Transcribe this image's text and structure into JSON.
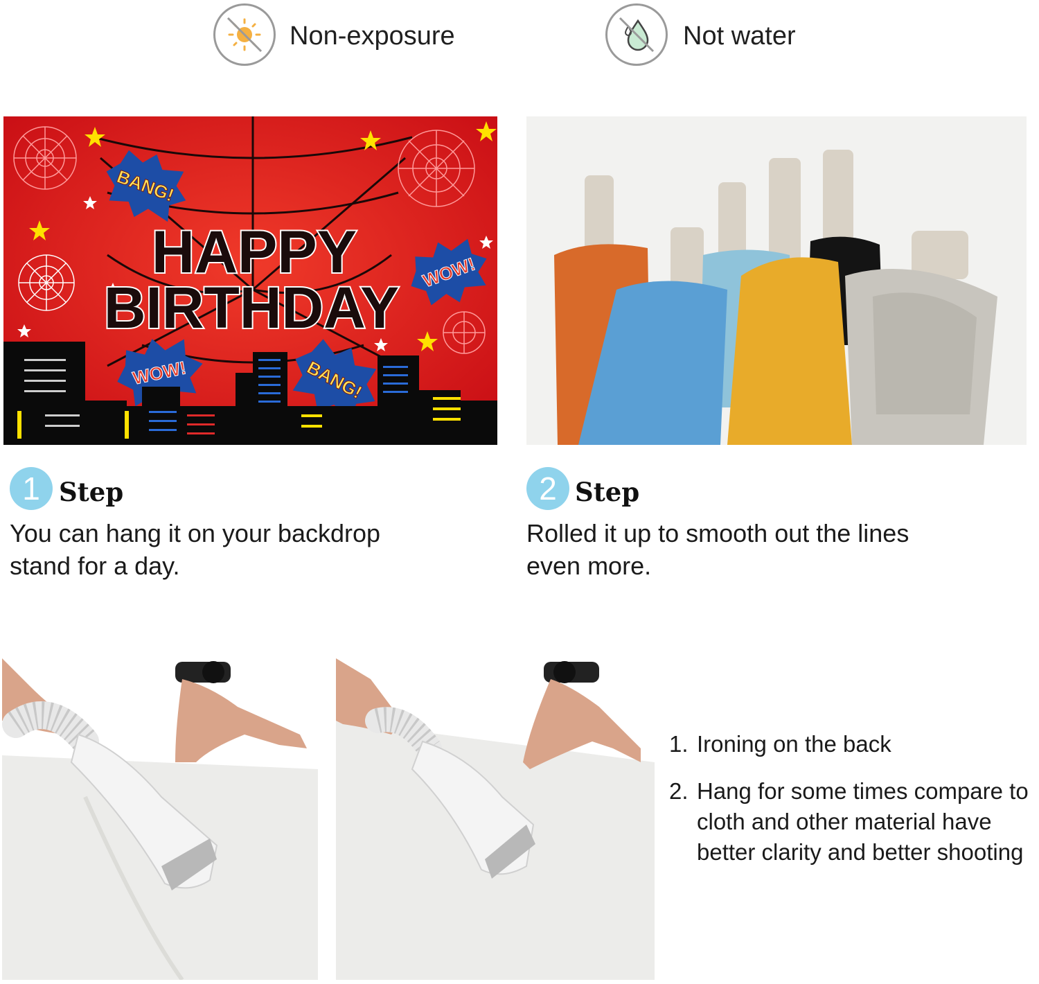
{
  "warnings": [
    {
      "icon": "no-sun-icon",
      "label": "Non-exposure"
    },
    {
      "icon": "no-water-icon",
      "label": "Not water"
    }
  ],
  "banner": {
    "title_line1": "HAPPY",
    "title_line2": "BIRTHDAY",
    "bubbles": [
      "BANG!",
      "WOW!",
      "WOW!",
      "BANG!"
    ]
  },
  "steps": [
    {
      "number": "1",
      "title": "Step",
      "text": "You can hang it on your backdrop stand for a day."
    },
    {
      "number": "2",
      "title": "Step",
      "text": "Rolled it up to smooth out the lines even more."
    }
  ],
  "instructions": [
    {
      "number": "1.",
      "text": "Ironing on the back"
    },
    {
      "number": "2.",
      "text": "Hang for some times compare to cloth and other material have better clarity and better shooting"
    }
  ],
  "colors": {
    "badge": "#8fd3ec",
    "banner_red": "#d8141a"
  }
}
